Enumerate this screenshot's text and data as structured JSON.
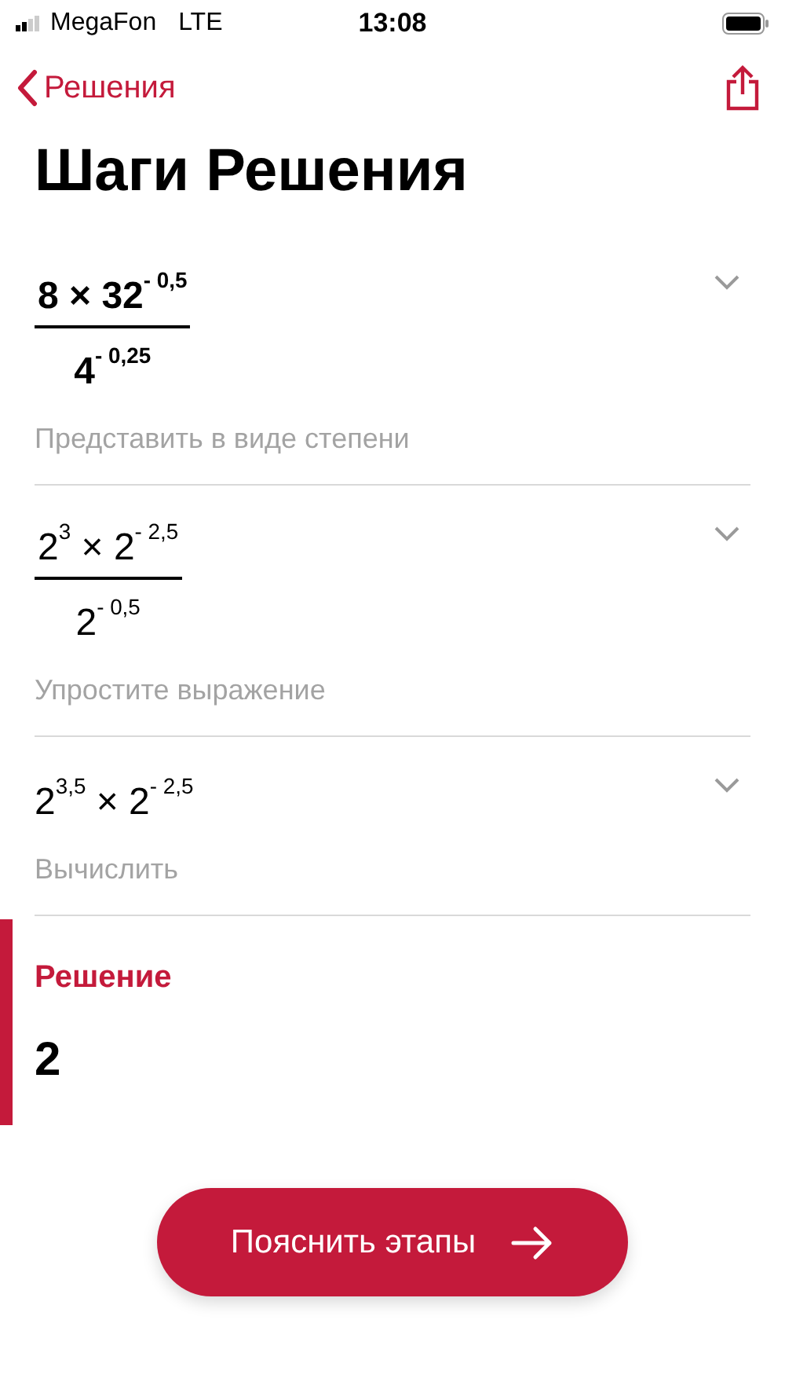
{
  "status_bar": {
    "carrier": "MegaFon",
    "network": "LTE",
    "time": "13:08"
  },
  "nav": {
    "back_label": "Решения"
  },
  "title": "Шаги Решения",
  "steps": [
    {
      "kind": "fraction",
      "bold": true,
      "expanded": false,
      "numerator": "8 × 32$^{- 0,5}$",
      "denominator": "4$^{- 0,25}$",
      "caption": "Представить в виде степени"
    },
    {
      "kind": "fraction",
      "bold": false,
      "expanded": false,
      "numerator": "2$^{3}$ × 2$^{- 2,5}$",
      "denominator": "2$^{- 0,5}$",
      "caption": "Упростите выражение"
    },
    {
      "kind": "inline",
      "bold": false,
      "expanded": false,
      "expression": "2$^{3,5}$ × 2$^{- 2,5}$",
      "caption": "Вычислить"
    }
  ],
  "solution": {
    "heading": "Решение",
    "value": "2"
  },
  "explain_button": {
    "label": "Пояснить этапы"
  }
}
